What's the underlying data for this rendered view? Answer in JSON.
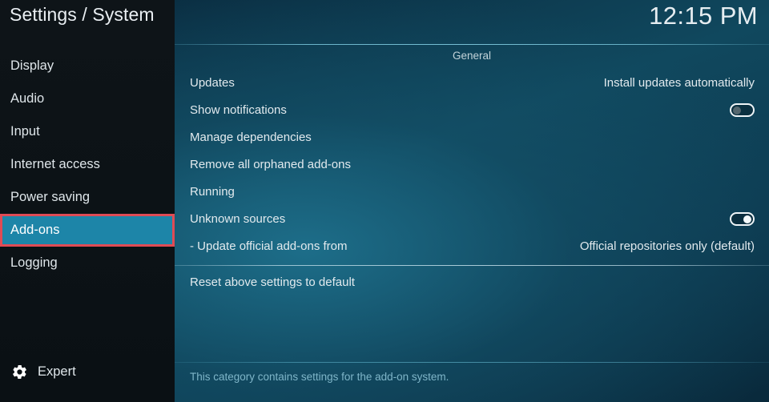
{
  "window": {
    "title": "Settings / System",
    "clock": "12:15 PM"
  },
  "colors": {
    "sidebar_bg": "#0d1317",
    "selection_bg": "#1d85a8",
    "selection_outline": "#e04b55",
    "content_accent": "#10485e",
    "separator": "#82cde2",
    "footer_text": "#7fb6c9"
  },
  "sidebar": {
    "items": [
      {
        "label": "Display",
        "selected": false
      },
      {
        "label": "Audio",
        "selected": false
      },
      {
        "label": "Input",
        "selected": false
      },
      {
        "label": "Internet access",
        "selected": false
      },
      {
        "label": "Power saving",
        "selected": false
      },
      {
        "label": "Add-ons",
        "selected": true
      },
      {
        "label": "Logging",
        "selected": false
      }
    ],
    "level_button": {
      "icon": "gear-icon",
      "label": "Expert"
    }
  },
  "main": {
    "group_title": "General",
    "rows": [
      {
        "label": "Updates",
        "control": "value",
        "value": "Install updates automatically",
        "separator_above": false
      },
      {
        "label": "Show notifications",
        "control": "toggle",
        "value": "off",
        "separator_above": false
      },
      {
        "label": "Manage dependencies",
        "control": "none",
        "value": "",
        "separator_above": false
      },
      {
        "label": "Remove all orphaned add-ons",
        "control": "none",
        "value": "",
        "separator_above": false
      },
      {
        "label": "Running",
        "control": "none",
        "value": "",
        "separator_above": false
      },
      {
        "label": "Unknown sources",
        "control": "toggle",
        "value": "on",
        "separator_above": false
      },
      {
        "label": "- Update official add-ons from",
        "control": "value",
        "value": "Official repositories only (default)",
        "separator_above": false
      },
      {
        "label": "Reset above settings to default",
        "control": "none",
        "value": "",
        "separator_above": true
      }
    ],
    "description": "This category contains settings for the add-on system."
  }
}
